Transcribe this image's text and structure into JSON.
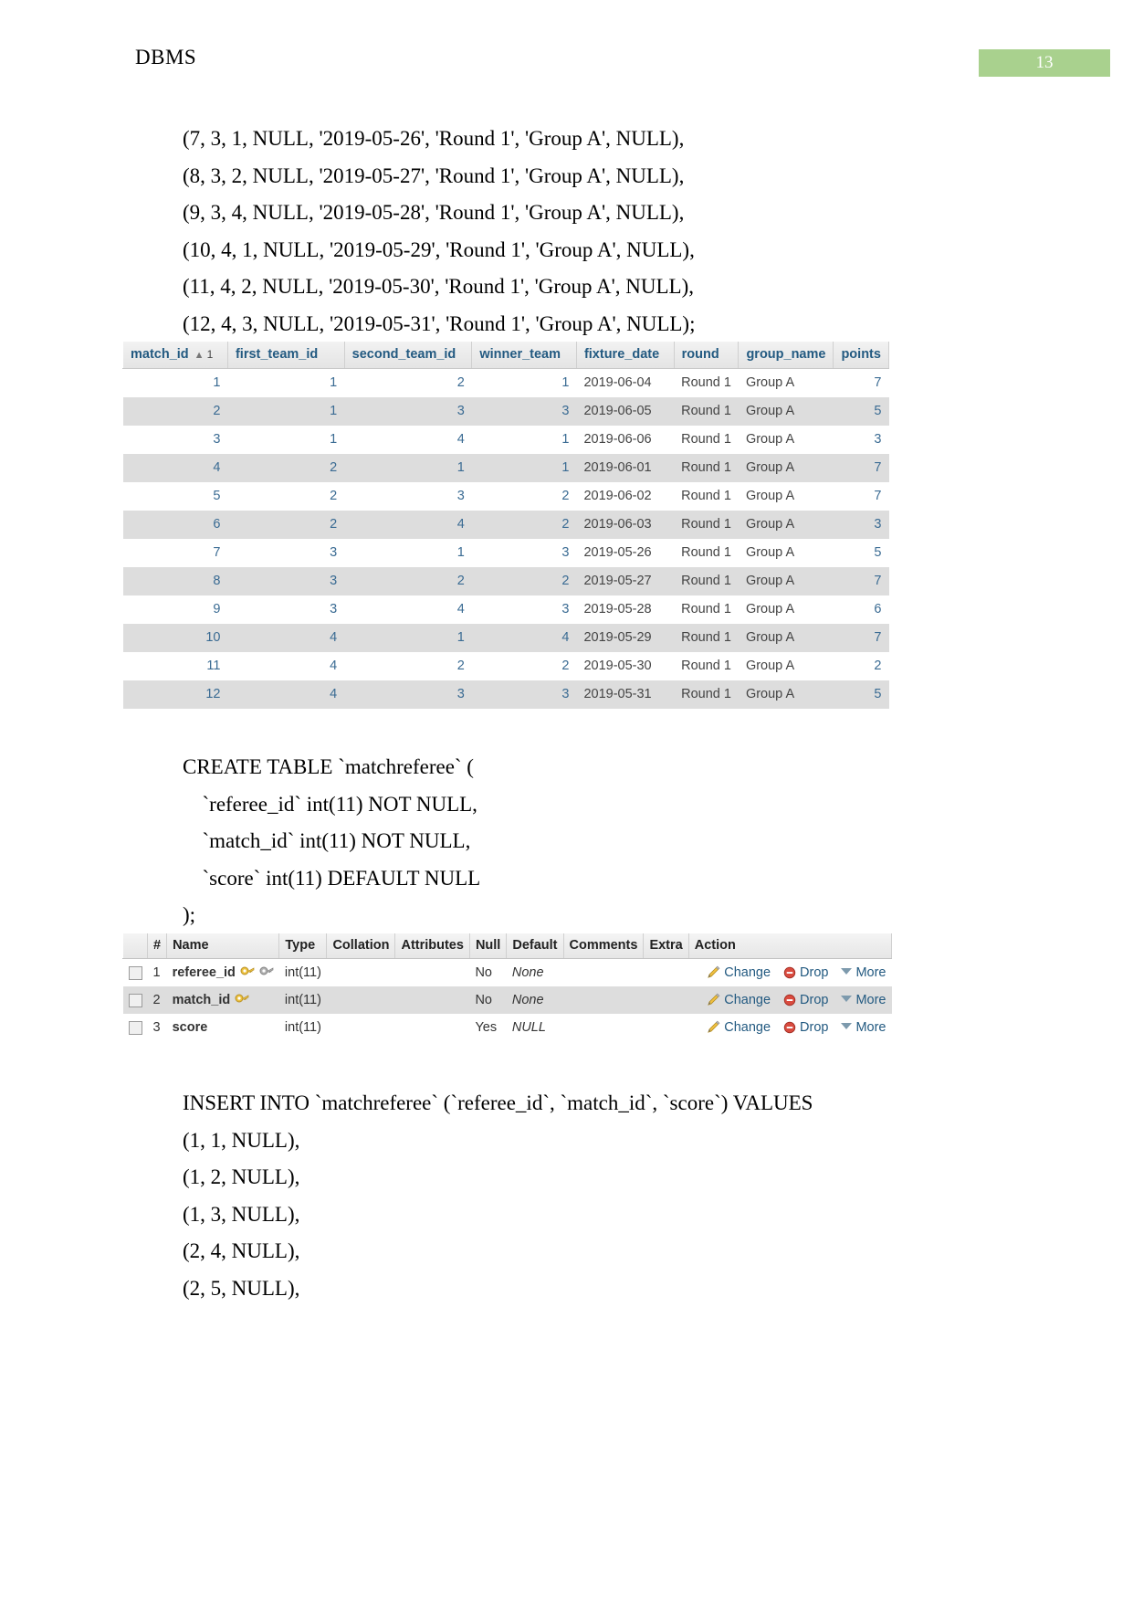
{
  "header": {
    "title": "DBMS",
    "page_number": "13"
  },
  "sql_block_1": {
    "lines": [
      "(7, 3, 1, NULL, '2019-05-26', 'Round 1', 'Group A', NULL),",
      "(8, 3, 2, NULL, '2019-05-27', 'Round 1', 'Group A', NULL),",
      "(9, 3, 4, NULL, '2019-05-28', 'Round 1', 'Group A', NULL),",
      "(10, 4, 1, NULL, '2019-05-29', 'Round 1', 'Group A', NULL),",
      "(11, 4, 2, NULL, '2019-05-30', 'Round 1', 'Group A', NULL),",
      "(12, 4, 3, NULL, '2019-05-31', 'Round 1', 'Group A', NULL);"
    ]
  },
  "matches_table": {
    "sort_indicator": "▲",
    "sort_order": "1",
    "columns": [
      "match_id",
      "first_team_id",
      "second_team_id",
      "winner_team",
      "fixture_date",
      "round",
      "group_name",
      "points"
    ],
    "rows": [
      [
        "1",
        "1",
        "2",
        "1",
        "2019-06-04",
        "Round 1",
        "Group A",
        "7"
      ],
      [
        "2",
        "1",
        "3",
        "3",
        "2019-06-05",
        "Round 1",
        "Group A",
        "5"
      ],
      [
        "3",
        "1",
        "4",
        "1",
        "2019-06-06",
        "Round 1",
        "Group A",
        "3"
      ],
      [
        "4",
        "2",
        "1",
        "1",
        "2019-06-01",
        "Round 1",
        "Group A",
        "7"
      ],
      [
        "5",
        "2",
        "3",
        "2",
        "2019-06-02",
        "Round 1",
        "Group A",
        "7"
      ],
      [
        "6",
        "2",
        "4",
        "2",
        "2019-06-03",
        "Round 1",
        "Group A",
        "3"
      ],
      [
        "7",
        "3",
        "1",
        "3",
        "2019-05-26",
        "Round 1",
        "Group A",
        "5"
      ],
      [
        "8",
        "3",
        "2",
        "2",
        "2019-05-27",
        "Round 1",
        "Group A",
        "7"
      ],
      [
        "9",
        "3",
        "4",
        "3",
        "2019-05-28",
        "Round 1",
        "Group A",
        "6"
      ],
      [
        "10",
        "4",
        "1",
        "4",
        "2019-05-29",
        "Round 1",
        "Group A",
        "7"
      ],
      [
        "11",
        "4",
        "2",
        "2",
        "2019-05-30",
        "Round 1",
        "Group A",
        "2"
      ],
      [
        "12",
        "4",
        "3",
        "3",
        "2019-05-31",
        "Round 1",
        "Group A",
        "5"
      ]
    ]
  },
  "sql_block_2": {
    "lines": [
      "CREATE TABLE `matchreferee` (",
      "  `referee_id` int(11) NOT NULL,",
      "  `match_id` int(11) NOT NULL,",
      "  `score` int(11) DEFAULT NULL",
      ");"
    ]
  },
  "structure_table": {
    "columns": [
      "#",
      "Name",
      "Type",
      "Collation",
      "Attributes",
      "Null",
      "Default",
      "Comments",
      "Extra",
      "Action"
    ],
    "rows": [
      {
        "index": "1",
        "name": "referee_id",
        "keys": [
          "primary-key-gold",
          "index-key-silver"
        ],
        "type": "int(11)",
        "collation": "",
        "attributes": "",
        "null": "No",
        "default": "None",
        "comments": "",
        "extra": "",
        "actions": [
          "Change",
          "Drop",
          "More"
        ]
      },
      {
        "index": "2",
        "name": "match_id",
        "keys": [
          "primary-key-gold"
        ],
        "type": "int(11)",
        "collation": "",
        "attributes": "",
        "null": "No",
        "default": "None",
        "comments": "",
        "extra": "",
        "actions": [
          "Change",
          "Drop",
          "More"
        ]
      },
      {
        "index": "3",
        "name": "score",
        "keys": [],
        "type": "int(11)",
        "collation": "",
        "attributes": "",
        "null": "Yes",
        "default": "NULL",
        "comments": "",
        "extra": "",
        "actions": [
          "Change",
          "Drop",
          "More"
        ]
      }
    ]
  },
  "sql_block_3": {
    "lines": [
      "INSERT INTO `matchreferee` (`referee_id`, `match_id`, `score`) VALUES",
      "(1, 1, NULL),",
      "(1, 2, NULL),",
      "(1, 3, NULL),",
      "(2, 4, NULL),",
      "(2, 5, NULL),"
    ]
  },
  "colors": {
    "badge_green": "#a9d18e",
    "header_link_blue": "#235a81",
    "numeric_blue": "#3a6b93",
    "row_alt_gray": "#dddddd",
    "drop_red": "#cc3333",
    "key_gold": "#e8c34a",
    "key_silver": "#aaaaaa"
  }
}
